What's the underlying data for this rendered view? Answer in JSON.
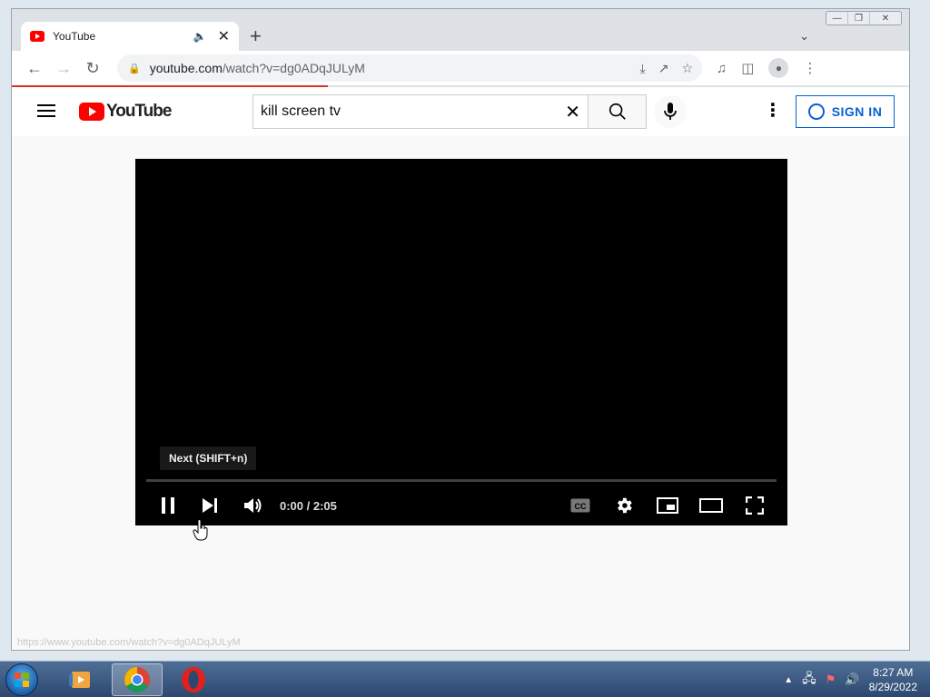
{
  "browser": {
    "tab": {
      "title": "YouTube"
    },
    "url": {
      "host": "youtube.com",
      "path": "/watch?v=dg0ADqJULyM"
    }
  },
  "youtube": {
    "logo_text": "YouTube",
    "search": {
      "value": "kill screen tv"
    },
    "sign_in_label": "SIGN IN"
  },
  "player": {
    "tooltip": "Next (SHIFT+n)",
    "time": "0:00 / 2:05",
    "cc_label": "CC",
    "progress": 0
  },
  "status_bar": {
    "url": "https://www.youtube.com/watch?v=dg0ADqJULyM"
  },
  "taskbar": {
    "clock_time": "8:27 AM",
    "clock_date": "8/29/2022"
  },
  "colors": {
    "youtube_red": "#ff0000",
    "sign_in_blue": "#065fd4",
    "loading_bar": "#d93025"
  },
  "icons": [
    "menu-icon",
    "search-icon",
    "mic-icon",
    "more-vert-icon",
    "account-icon",
    "pause-icon",
    "next-icon",
    "volume-icon",
    "cc-icon",
    "settings-icon",
    "miniplayer-icon",
    "theater-icon",
    "fullscreen-icon"
  ]
}
